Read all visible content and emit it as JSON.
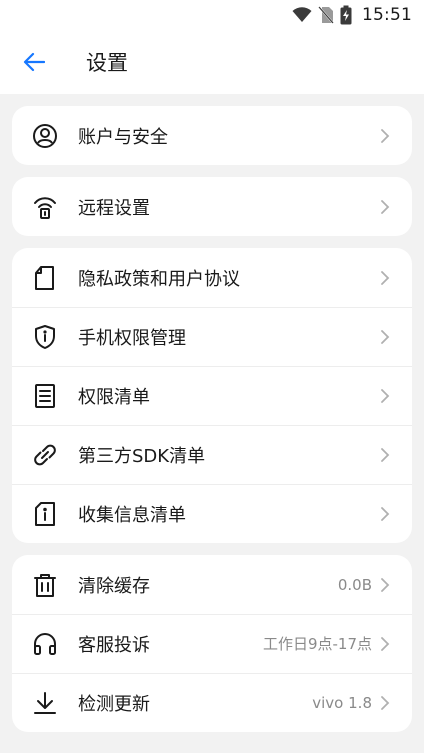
{
  "status_bar": {
    "time": "15:51"
  },
  "header": {
    "title": "设置"
  },
  "groups": [
    {
      "items": [
        {
          "label": "账户与安全",
          "icon": "account-circle-icon"
        }
      ]
    },
    {
      "items": [
        {
          "label": "远程设置",
          "icon": "remote-antenna-icon"
        }
      ]
    },
    {
      "items": [
        {
          "label": "隐私政策和用户协议",
          "icon": "document-icon"
        },
        {
          "label": "手机权限管理",
          "icon": "shield-icon"
        },
        {
          "label": "权限清单",
          "icon": "list-icon"
        },
        {
          "label": "第三方SDK清单",
          "icon": "link-icon"
        },
        {
          "label": "收集信息清单",
          "icon": "info-document-icon"
        }
      ]
    },
    {
      "items": [
        {
          "label": "清除缓存",
          "value": "0.0B",
          "icon": "trash-icon"
        },
        {
          "label": "客服投诉",
          "value": "工作日9点-17点",
          "icon": "headset-icon"
        },
        {
          "label": "检测更新",
          "value": "vivo 1.8",
          "icon": "download-icon"
        }
      ]
    }
  ],
  "colors": {
    "accent": "#1677ff",
    "background": "#f2f2f2",
    "card": "#ffffff"
  }
}
